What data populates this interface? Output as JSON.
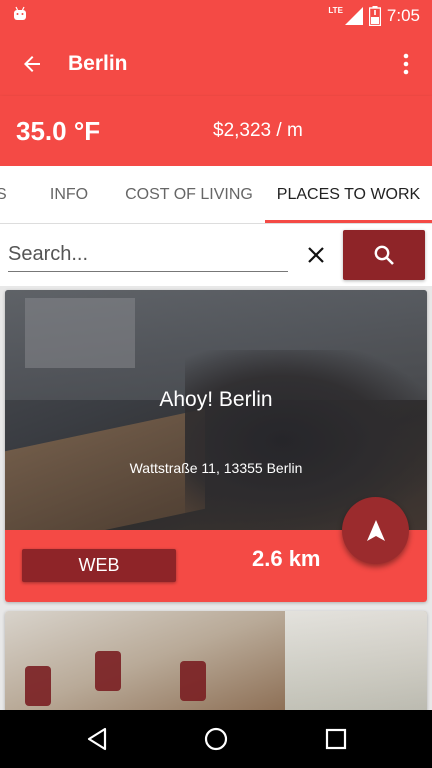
{
  "status_bar": {
    "network": "LTE",
    "time": "7:05"
  },
  "app_bar": {
    "title": "Berlin"
  },
  "summary": {
    "temperature": "35.0 °F",
    "cost": "$2,323 / m"
  },
  "tabs": [
    {
      "label": "ES"
    },
    {
      "label": "INFO"
    },
    {
      "label": "COST OF LIVING"
    },
    {
      "label": "PLACES TO WORK",
      "active": true
    }
  ],
  "search": {
    "placeholder": "Search..."
  },
  "places": [
    {
      "name": "Ahoy! Berlin",
      "address": "Wattstraße 11, 13355 Berlin",
      "button_label": "WEB",
      "distance": "2.6 km"
    }
  ],
  "colors": {
    "primary": "#f44a45",
    "dark_accent": "#8e2428"
  },
  "icons": [
    "android-icon",
    "lte-signal-icon",
    "battery-icon",
    "back-arrow-icon",
    "more-vert-icon",
    "close-icon",
    "search-icon",
    "navigation-arrow-icon",
    "nav-back-icon",
    "nav-home-icon",
    "nav-recents-icon"
  ]
}
